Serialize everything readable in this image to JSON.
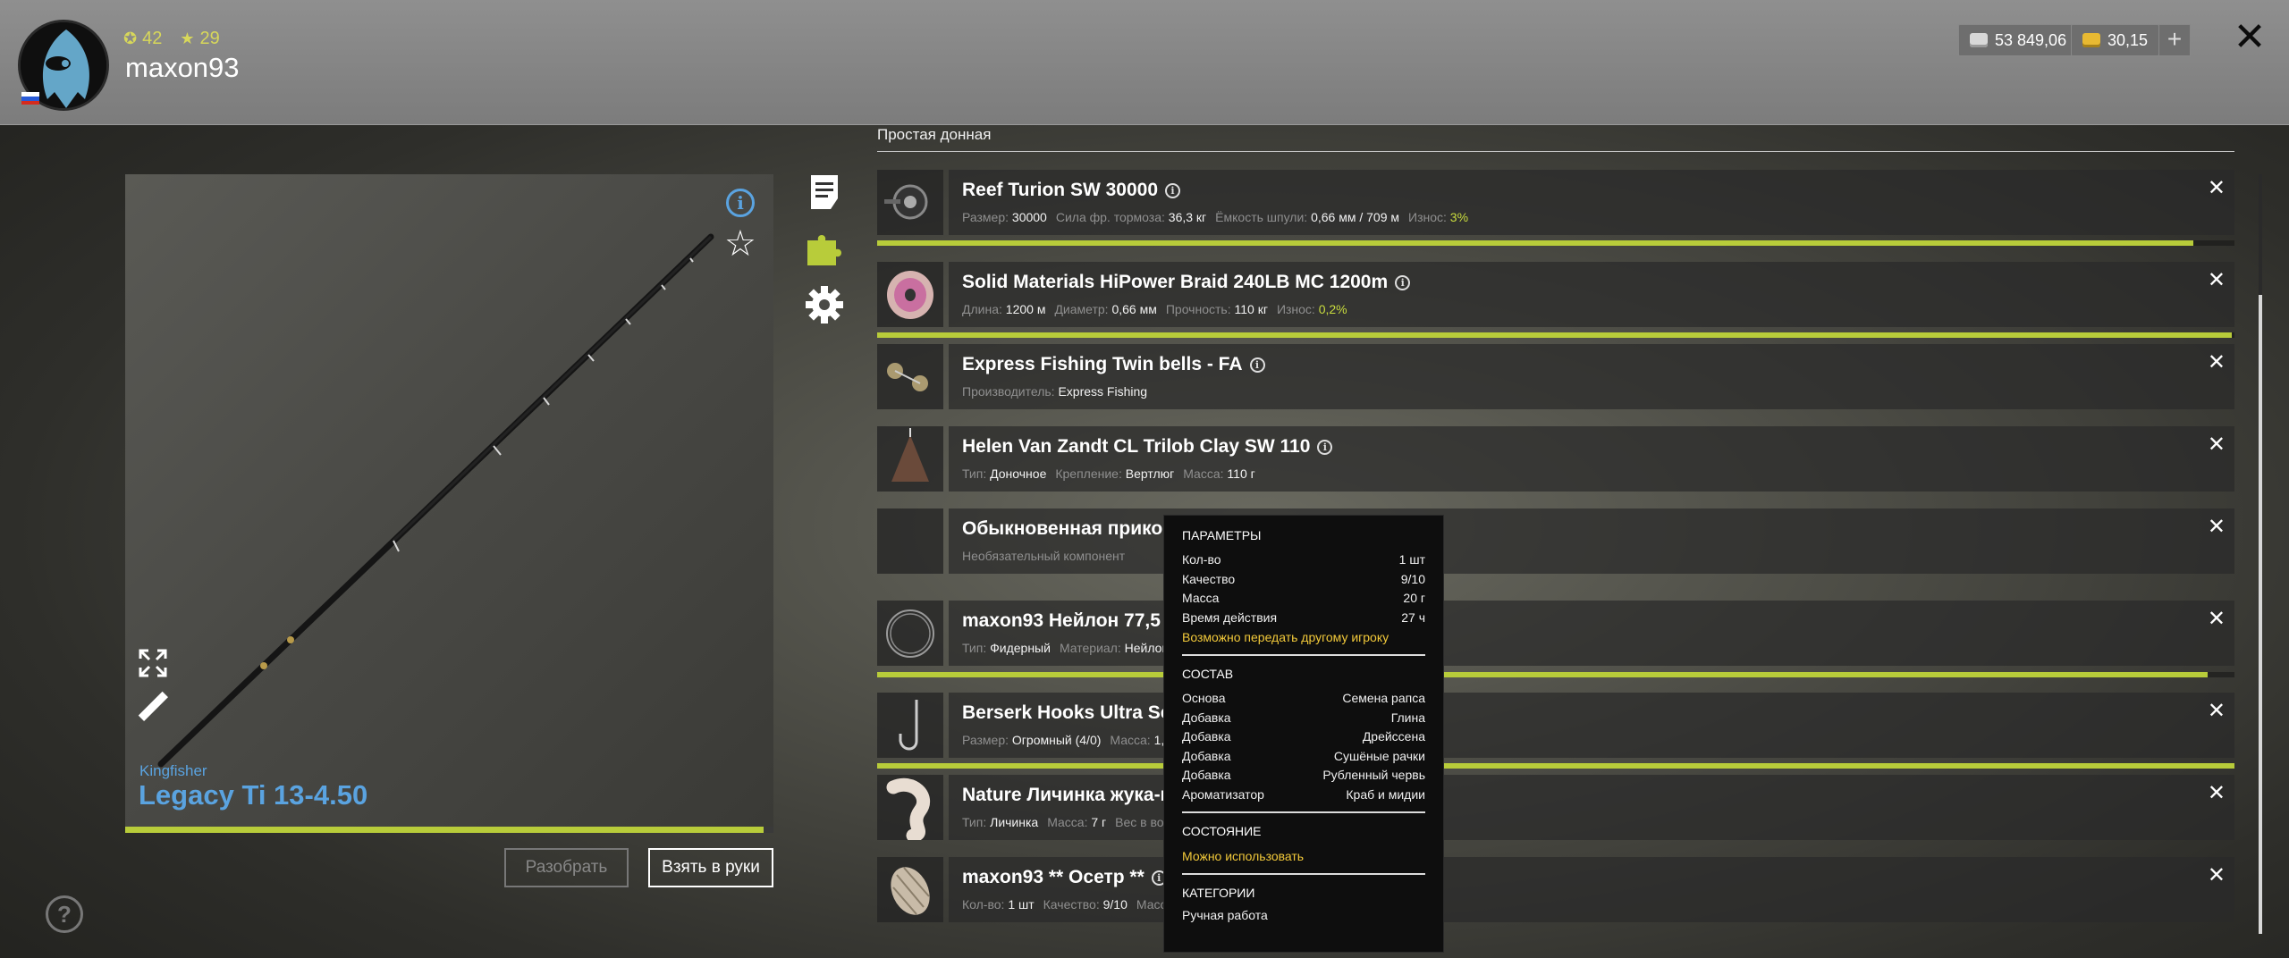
{
  "header": {
    "level": "42",
    "rank": "29",
    "username": "maxon93",
    "silver": "53 849,06",
    "gold": "30,15",
    "plus_label": "+",
    "close_label": "✕"
  },
  "rod": {
    "brand": "Kingfisher",
    "name": "Legacy Ti 13-4.50",
    "durability_fraction": 0.985,
    "disassemble_label": "Разобрать",
    "take_label": "Взять в руки"
  },
  "help_label": "?",
  "section_title": "Простая донная",
  "items": [
    {
      "name": "Reef Turion SW 30000",
      "props": [
        {
          "label": "Размер:",
          "value": "30000"
        },
        {
          "label": "Сила фр. тормоза:",
          "value": "36,3 кг"
        },
        {
          "label": "Ёмкость шпули:",
          "value": "0,66 мм / 709 м"
        },
        {
          "label": "Износ:",
          "value": "3%",
          "highlight": true
        }
      ],
      "wear_fraction": 0.97
    },
    {
      "name": "Solid Materials HiPower Braid 240LB MC 1200m",
      "props": [
        {
          "label": "Длина:",
          "value": "1200 м"
        },
        {
          "label": "Диаметр:",
          "value": "0,66 мм"
        },
        {
          "label": "Прочность:",
          "value": "110 кг"
        },
        {
          "label": "Износ:",
          "value": "0,2%",
          "highlight": true
        }
      ],
      "wear_fraction": 0.998
    },
    {
      "name": "Express Fishing Twin bells - FA",
      "props": [
        {
          "label": "Производитель:",
          "value": "Express Fishing"
        }
      ]
    },
    {
      "name": "Helen Van Zandt CL Trilob Clay SW 110",
      "props": [
        {
          "label": "Тип:",
          "value": "Доночное"
        },
        {
          "label": "Крепление:",
          "value": "Вертлюг"
        },
        {
          "label": "Масса:",
          "value": "110 г"
        }
      ]
    },
    {
      "name": "Обыкновенная прикор",
      "props": [
        {
          "label": "Необязательный компонент",
          "value": ""
        }
      ]
    },
    {
      "name": "maxon93 Нейлон 77,5 м",
      "props": [
        {
          "label": "Тип:",
          "value": "Фидерный"
        },
        {
          "label": "Материал:",
          "value": "Нейлон"
        }
      ],
      "wear_fraction": 0.98
    },
    {
      "name": "Berserk Hooks Ultra Ser",
      "props": [
        {
          "label": "Размер:",
          "value": "Огромный (4/0)"
        },
        {
          "label": "Масса:",
          "value": "1,"
        }
      ],
      "wear_fraction": 1.0
    },
    {
      "name": "Nature Личинка жука-н",
      "props": [
        {
          "label": "Тип:",
          "value": "Личинка"
        },
        {
          "label": "Масса:",
          "value": "7 г"
        },
        {
          "label": "Вес в вод",
          "value": ""
        }
      ]
    },
    {
      "name": "maxon93 ** Осетр **",
      "props": [
        {
          "label": "Кол-во:",
          "value": "1 шт"
        },
        {
          "label": "Качество:",
          "value": "9/10"
        },
        {
          "label": "Масс",
          "value": ""
        }
      ]
    }
  ],
  "tooltip": {
    "params_title": "ПАРАМЕТРЫ",
    "params": [
      {
        "k": "Кол-во",
        "v": "1 шт"
      },
      {
        "k": "Качество",
        "v": "9/10"
      },
      {
        "k": "Масса",
        "v": "20 г"
      },
      {
        "k": "Время действия",
        "v": "27 ч"
      }
    ],
    "transfer_note": "Возможно передать другому игроку",
    "composition_title": "СОСТАВ",
    "composition": [
      {
        "k": "Основа",
        "v": "Семена рапса"
      },
      {
        "k": "Добавка",
        "v": "Глина"
      },
      {
        "k": "Добавка",
        "v": "Дрейссена"
      },
      {
        "k": "Добавка",
        "v": "Сушёные рачки"
      },
      {
        "k": "Добавка",
        "v": "Рубленный червь"
      },
      {
        "k": "Ароматизатор",
        "v": "Краб и мидии"
      }
    ],
    "state_title": "СОСТОЯНИЕ",
    "state_value": "Можно использовать",
    "categories_title": "КАТЕГОРИИ",
    "categories_value": "Ручная работа"
  },
  "colors": {
    "accent_blue": "#5aa3e0",
    "wear_green": "#b8cc3a",
    "tooltip_yellow": "#f2c93a"
  }
}
